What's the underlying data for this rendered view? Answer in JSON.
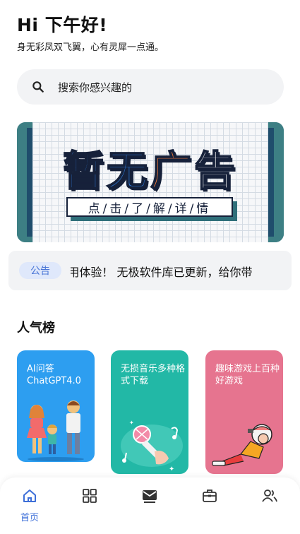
{
  "header": {
    "greeting": "Hi 下午好!",
    "subtitle": "身无彩凤双飞翼，心有灵犀一点通。"
  },
  "search": {
    "placeholder": "搜索你感兴趣的"
  },
  "banner": {
    "title_chars": [
      "暂",
      "无",
      "广",
      "告"
    ],
    "cta": "点/击/了/解/详/情"
  },
  "notice": {
    "tag": "公告",
    "text": "!用体验！  无极软件库已更新，给你带"
  },
  "popular": {
    "title": "人气榜",
    "cards": [
      {
        "label": "AI问答ChatGPT4.0"
      },
      {
        "label": "无损音乐多种格式下载"
      },
      {
        "label": "趣味游戏上百种好游戏"
      }
    ]
  },
  "tabbar": {
    "items": [
      {
        "label": "首页",
        "icon": "home-icon",
        "active": true
      },
      {
        "label": "",
        "icon": "grid-icon"
      },
      {
        "label": "",
        "icon": "mail-icon"
      },
      {
        "label": "",
        "icon": "toolbox-icon"
      },
      {
        "label": "",
        "icon": "users-icon"
      }
    ]
  },
  "colors": {
    "accent": "#3d6fd8",
    "card_ai": "#2d9ef0",
    "card_music": "#22b8a6",
    "card_game": "#e6748f"
  }
}
